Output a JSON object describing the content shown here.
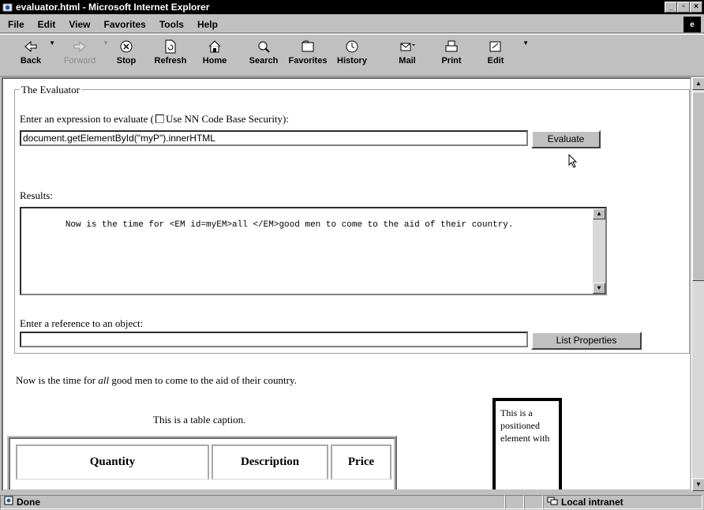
{
  "window": {
    "title": "evaluator.html - Microsoft Internet Explorer"
  },
  "menu": [
    {
      "label": "File"
    },
    {
      "label": "Edit"
    },
    {
      "label": "View"
    },
    {
      "label": "Favorites"
    },
    {
      "label": "Tools"
    },
    {
      "label": "Help"
    }
  ],
  "toolbar": [
    {
      "label": "Back",
      "icon": "back-arrow-icon"
    },
    {
      "label": "Forward",
      "icon": "forward-arrow-icon",
      "disabled": true
    },
    {
      "label": "Stop",
      "icon": "stop-icon"
    },
    {
      "label": "Refresh",
      "icon": "refresh-icon"
    },
    {
      "label": "Home",
      "icon": "home-icon"
    },
    {
      "label": "Search",
      "icon": "search-icon"
    },
    {
      "label": "Favorites",
      "icon": "favorites-icon"
    },
    {
      "label": "History",
      "icon": "history-icon"
    },
    {
      "label": "Mail",
      "icon": "mail-icon"
    },
    {
      "label": "Print",
      "icon": "print-icon"
    },
    {
      "label": "Edit",
      "icon": "edit-icon"
    }
  ],
  "evaluator": {
    "legend": "The Evaluator",
    "expr_label_pre": "Enter an expression to evaluate (",
    "expr_label_checkbox": "Use NN Code Base Security):",
    "expr_value": "document.getElementById(\"myP\").innerHTML",
    "evaluate_label": "Evaluate",
    "results_label": "Results:",
    "results_value": "Now is the time for <EM id=myEM>all </EM>good men to come to the aid of their country.",
    "ref_label": "Enter a reference to an object:",
    "ref_value": "",
    "list_props_label": "List Properties"
  },
  "page": {
    "para_before": "Now is the time for ",
    "para_em": "all",
    "para_after": " good men to come to the aid of their country.",
    "table_caption": "This is a table caption.",
    "table_headers": [
      "Quantity",
      "Description",
      "Price"
    ],
    "positioned_text": "This is a positioned element with"
  },
  "status": {
    "text": "Done",
    "zone": "Local intranet"
  }
}
